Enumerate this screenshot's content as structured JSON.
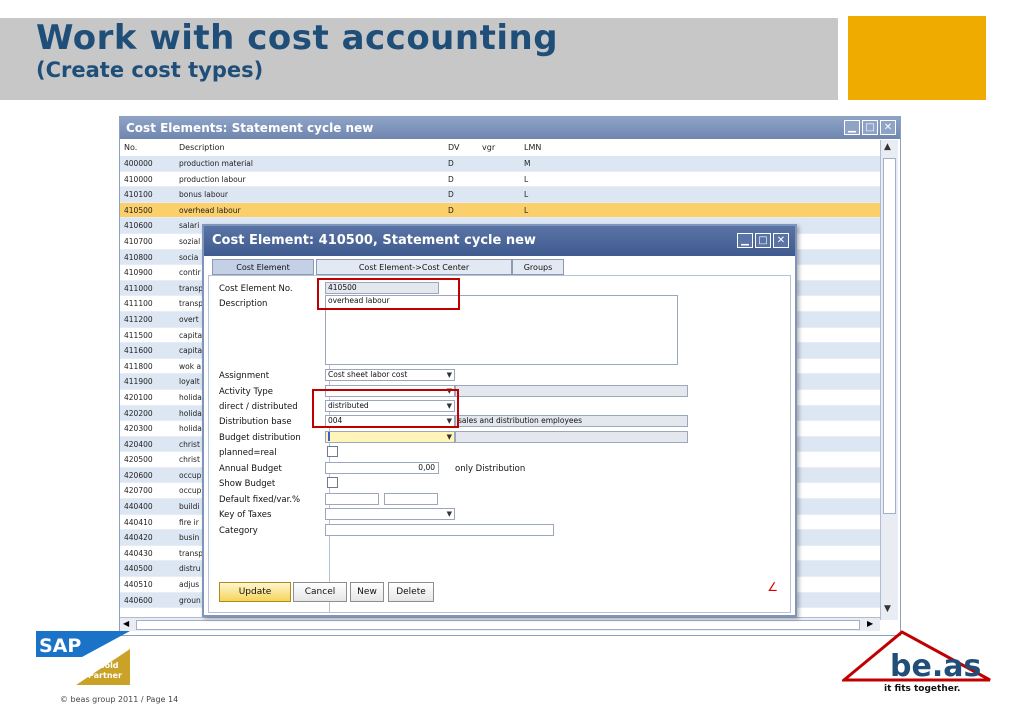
{
  "slide": {
    "title": "Work with cost accounting",
    "subtitle": "(Create cost types)",
    "footer": "© beas group 2011 / Page 14"
  },
  "outer_window": {
    "title": "Cost Elements: Statement cycle new",
    "columns": [
      "No.",
      "Description",
      "DV",
      "vgr",
      "LMN"
    ],
    "rows": [
      {
        "no": "400000",
        "desc": "production material",
        "dv": "D",
        "lmn": "M"
      },
      {
        "no": "410000",
        "desc": "production labour",
        "dv": "D",
        "lmn": "L"
      },
      {
        "no": "410100",
        "desc": "bonus labour",
        "dv": "D",
        "lmn": "L"
      },
      {
        "no": "410500",
        "desc": "overhead labour",
        "dv": "D",
        "lmn": "L"
      },
      {
        "no": "410600",
        "desc": "salari",
        "dv": "",
        "lmn": ""
      },
      {
        "no": "410700",
        "desc": "sozial",
        "dv": "",
        "lmn": ""
      },
      {
        "no": "410800",
        "desc": "socia",
        "dv": "",
        "lmn": ""
      },
      {
        "no": "410900",
        "desc": "contir",
        "dv": "",
        "lmn": ""
      },
      {
        "no": "411000",
        "desc": "transp",
        "dv": "",
        "lmn": ""
      },
      {
        "no": "411100",
        "desc": "transp",
        "dv": "",
        "lmn": ""
      },
      {
        "no": "411200",
        "desc": "overt",
        "dv": "",
        "lmn": ""
      },
      {
        "no": "411500",
        "desc": "capita",
        "dv": "",
        "lmn": ""
      },
      {
        "no": "411600",
        "desc": "capita",
        "dv": "",
        "lmn": ""
      },
      {
        "no": "411800",
        "desc": "wok a",
        "dv": "",
        "lmn": ""
      },
      {
        "no": "411900",
        "desc": "loyalt",
        "dv": "",
        "lmn": ""
      },
      {
        "no": "420100",
        "desc": "holida",
        "dv": "",
        "lmn": ""
      },
      {
        "no": "420200",
        "desc": "holida",
        "dv": "",
        "lmn": ""
      },
      {
        "no": "420300",
        "desc": "holida",
        "dv": "",
        "lmn": ""
      },
      {
        "no": "420400",
        "desc": "christ",
        "dv": "",
        "lmn": ""
      },
      {
        "no": "420500",
        "desc": "christ",
        "dv": "",
        "lmn": ""
      },
      {
        "no": "420600",
        "desc": "occup",
        "dv": "",
        "lmn": ""
      },
      {
        "no": "420700",
        "desc": "occup",
        "dv": "",
        "lmn": ""
      },
      {
        "no": "440400",
        "desc": "buildi",
        "dv": "",
        "lmn": ""
      },
      {
        "no": "440410",
        "desc": "fire ir",
        "dv": "",
        "lmn": ""
      },
      {
        "no": "440420",
        "desc": "busin",
        "dv": "",
        "lmn": ""
      },
      {
        "no": "440430",
        "desc": "transp",
        "dv": "",
        "lmn": ""
      },
      {
        "no": "440500",
        "desc": "distru",
        "dv": "",
        "lmn": ""
      },
      {
        "no": "440510",
        "desc": "adjus",
        "dv": "",
        "lmn": ""
      },
      {
        "no": "440600",
        "desc": "groun",
        "dv": "",
        "lmn": ""
      }
    ],
    "selected_row": 3
  },
  "dialog": {
    "title": "Cost Element: 410500, Statement cycle new",
    "tabs": [
      "Cost Element",
      "Cost Element->Cost Center",
      "Groups"
    ],
    "labels": {
      "cost_element_no": "Cost Element No.",
      "description": "Description",
      "assignment": "Assignment",
      "activity_type": "Activity Type",
      "direct_distributed": "direct / distributed",
      "distribution_base": "Distribution base",
      "budget_distribution": "Budget distribution",
      "planned_real": "planned=real",
      "annual_budget": "Annual Budget",
      "show_budget": "Show Budget",
      "default_fixed_var": "Default fixed/var.%",
      "key_of_taxes": "Key of Taxes",
      "category": "Category"
    },
    "values": {
      "cost_element_no": "410500",
      "description": "overhead labour",
      "assignment": "Cost sheet labor cost",
      "direct_distributed": "distributed",
      "distribution_base": "004",
      "distribution_base_desc": "sales and distribution employees",
      "annual_budget": "0,00",
      "annual_budget_note": "only Distribution"
    },
    "buttons": {
      "update": "Update",
      "cancel": "Cancel",
      "new": "New",
      "delete": "Delete"
    }
  },
  "logos": {
    "sap_gold": "Gold",
    "sap_partner": "Partner",
    "beas_tagline": "it fits together."
  }
}
